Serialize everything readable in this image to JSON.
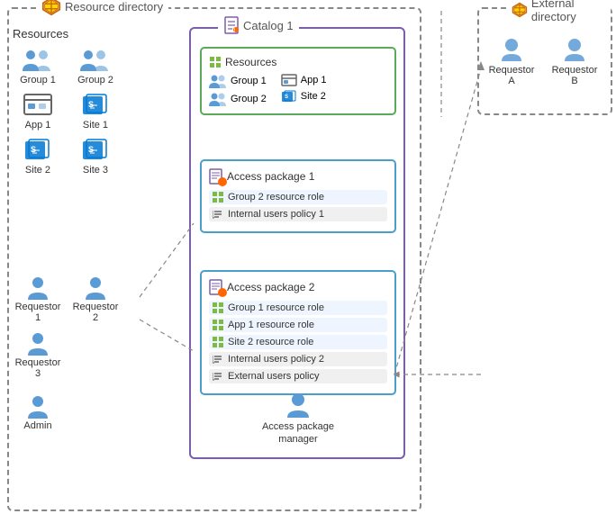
{
  "resourceDirectory": {
    "label": "Resource directory"
  },
  "externalDirectory": {
    "label": "External directory"
  },
  "resources": {
    "title": "Resources",
    "items": [
      {
        "name": "Group 1",
        "type": "group"
      },
      {
        "name": "Group 2",
        "type": "group"
      },
      {
        "name": "App 1",
        "type": "app"
      },
      {
        "name": "Site 1",
        "type": "site"
      },
      {
        "name": "Site 2",
        "type": "site"
      },
      {
        "name": "Site 3",
        "type": "site"
      }
    ]
  },
  "requestors": {
    "items": [
      {
        "name": "Requestor 1",
        "type": "person"
      },
      {
        "name": "Requestor 2",
        "type": "person"
      },
      {
        "name": "Requestor 3",
        "type": "person"
      }
    ]
  },
  "admin": {
    "name": "Admin",
    "type": "person"
  },
  "catalog": {
    "title": "Catalog 1"
  },
  "catalogResources": {
    "title": "Resources",
    "left": [
      {
        "name": "Group 1",
        "type": "group"
      },
      {
        "name": "Group 2",
        "type": "group"
      }
    ],
    "right": [
      {
        "name": "App 1",
        "type": "app"
      },
      {
        "name": "Site 2",
        "type": "site"
      }
    ]
  },
  "accessPackage1": {
    "title": "Access package 1",
    "roles": [
      {
        "label": "Group 2 resource role",
        "type": "role"
      },
      {
        "label": "Internal users policy 1",
        "type": "policy"
      }
    ]
  },
  "accessPackage2": {
    "title": "Access package 2",
    "roles": [
      {
        "label": "Group 1 resource role",
        "type": "role"
      },
      {
        "label": "App 1 resource role",
        "type": "role"
      },
      {
        "label": "Site 2 resource role",
        "type": "role"
      },
      {
        "label": "Internal users policy 2",
        "type": "policy"
      },
      {
        "label": "External users policy",
        "type": "policy"
      }
    ]
  },
  "accessPackageManager": {
    "name": "Access package\nmanager",
    "label1": "Access package",
    "label2": "manager"
  },
  "externalUsers": {
    "items": [
      {
        "name": "Requestor A",
        "type": "person"
      },
      {
        "name": "Requestor B",
        "type": "person"
      }
    ]
  }
}
